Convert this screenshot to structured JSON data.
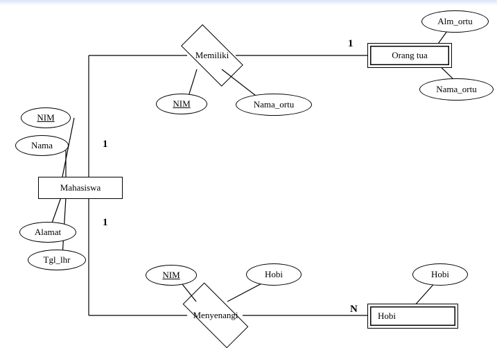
{
  "diagram": {
    "entities": {
      "mahasiswa": "Mahasiswa",
      "orang_tua": "Orang tua",
      "hobi": "Hobi"
    },
    "relationships": {
      "memiliki": "Memiliki",
      "menyenangi": "Menyenangi"
    },
    "attributes": {
      "mahasiswa_nim": "NIM",
      "mahasiswa_nama": "Nama",
      "mahasiswa_alamat": "Alamat",
      "mahasiswa_tgl_lhr": "Tgl_lhr",
      "memiliki_nim": "NIM",
      "memiliki_nama_ortu": "Nama_ortu",
      "orangtua_alm_ortu": "Alm_ortu",
      "orangtua_nama_ortu": "Nama_ortu",
      "menyenangi_nim": "NIM",
      "menyenangi_hobi": "Hobi",
      "hobi_hobi": "Hobi"
    },
    "cardinalities": {
      "mahasiswa_memiliki": "1",
      "memiliki_orangtua": "1",
      "mahasiswa_menyenangi": "1",
      "menyenangi_hobi": "N"
    }
  }
}
